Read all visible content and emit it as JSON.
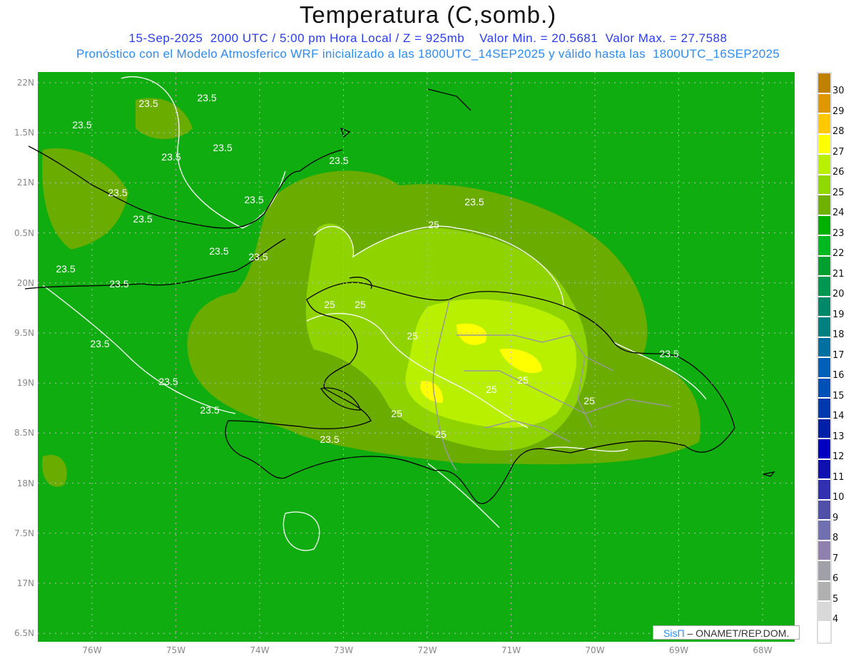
{
  "header": {
    "title": "Temperatura (C,somb.)",
    "line1": "15-Sep-2025  2000 UTC / 5:00 pm Hora Local / Z = 925mb    Valor Min. = 20.5681  Valor Max. = 27.7588",
    "line2": "Pronóstico con el Modelo Atmosferico WRF inicializado a las 1800UTC_14SEP2025 y válido hasta las  1800UTC_16SEP2025"
  },
  "axes": {
    "lat_labels": [
      "22N",
      "1.5N",
      "21N",
      "0.5N",
      "20N",
      "9.5N",
      "19N",
      "8.5N",
      "18N",
      "7.5N",
      "17N",
      "6.5N"
    ],
    "lon_labels": [
      "76W",
      "75W",
      "74W",
      "73W",
      "72W",
      "71W",
      "70W",
      "69W",
      "68W"
    ]
  },
  "colorbar": {
    "labels": [
      "30",
      "29",
      "28",
      "27",
      "26",
      "25",
      "24",
      "23",
      "22",
      "21",
      "20",
      "19",
      "18",
      "17",
      "16",
      "15",
      "14",
      "13",
      "12",
      "11",
      "10",
      "9",
      "8",
      "7",
      "6",
      "5",
      "4"
    ],
    "colors": [
      "#c08000",
      "#e09800",
      "#ffc800",
      "#ffff00",
      "#b8f000",
      "#90d800",
      "#70b000",
      "#00b000",
      "#00b820",
      "#00a030",
      "#009850",
      "#008868",
      "#008080",
      "#0070a0",
      "#0060b8",
      "#0050b8",
      "#0038b0",
      "#0020a8",
      "#0000c0",
      "#1010b0",
      "#3030b0",
      "#5050a8",
      "#7070b0",
      "#9080b0",
      "#a0a0a8",
      "#b0b0b0",
      "#d8d8d8",
      "#ffffff"
    ]
  },
  "contour_labels": [
    "23.5",
    "23.5",
    "23.5",
    "23.5",
    "23.5",
    "23.5",
    "23.5",
    "23.5",
    "23.5",
    "23.5",
    "23.5",
    "23.5",
    "23.5",
    "23.5",
    "23.5",
    "23.5",
    "23.5",
    "23.5",
    "23.5",
    "25",
    "25",
    "25",
    "25",
    "25",
    "25",
    "25",
    "25",
    "25"
  ],
  "credit": {
    "brand": "SisΠ",
    "text": " –  ONAMET/REP.DOM."
  },
  "colors": {
    "base": "#10ad10",
    "lvl24": "#6aac00",
    "lvl25": "#8fd400",
    "lvl26": "#b8f000",
    "lvl27": "#ffff00"
  }
}
